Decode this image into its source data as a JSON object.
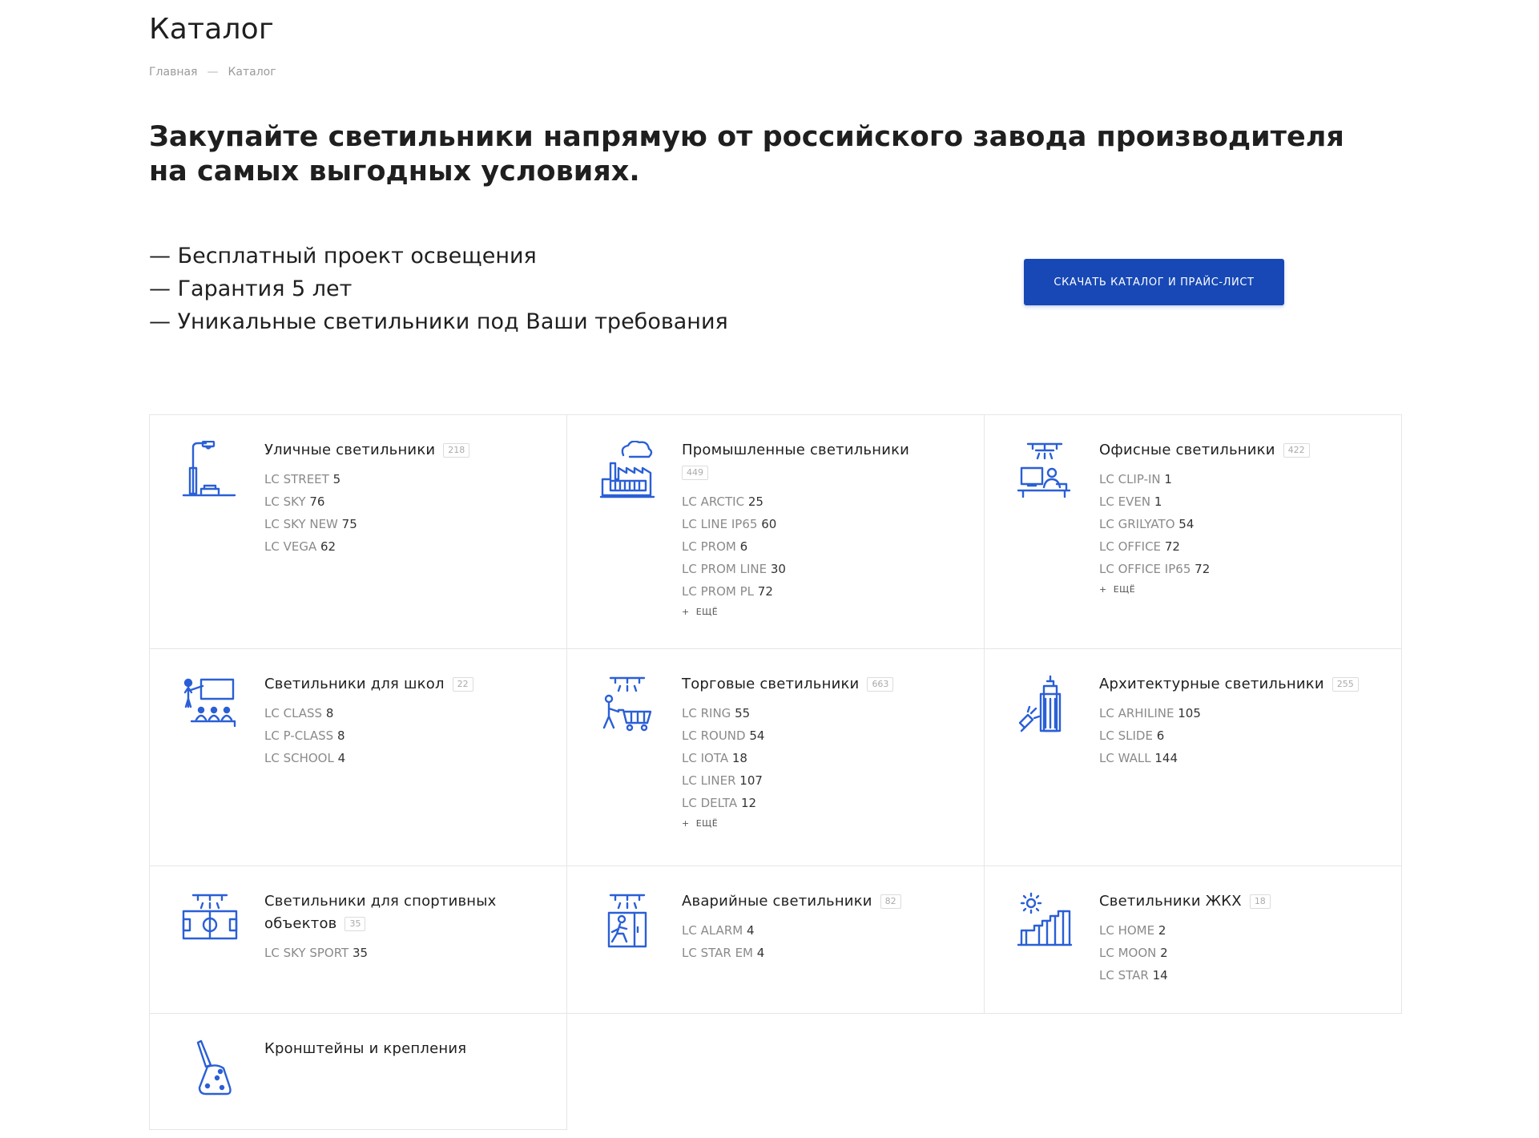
{
  "page": {
    "title": "Каталог",
    "breadcrumb": {
      "home": "Главная",
      "separator": "—",
      "current": "Каталог"
    },
    "headline": "Закупайте светильники напрямую от российского завода производителя на самых выгодных условиях.",
    "benefits": [
      "— Бесплатный проект освещения",
      "— Гарантия 5 лет",
      "— Уникальные светильники под Ваши требования"
    ],
    "cta_label": "СКАЧАТЬ КАТАЛОГ И ПРАЙС-ЛИСТ"
  },
  "theme": {
    "accent": "#1748b6",
    "icon": "#2a5fd6",
    "border": "#e6e6e6",
    "muted": "#8a8a8a"
  },
  "more_label": "ЕЩЁ",
  "more_plus": "+",
  "categories": [
    {
      "title": "Уличные светильники",
      "count": "218",
      "icon": "street-light-icon",
      "items": [
        {
          "name": "LC STREET",
          "count": "5"
        },
        {
          "name": "LC SKY",
          "count": "76"
        },
        {
          "name": "LC SKY NEW",
          "count": "75"
        },
        {
          "name": "LC VEGA",
          "count": "62"
        }
      ]
    },
    {
      "title": "Промышленные светильники",
      "count": "449",
      "icon": "factory-icon",
      "items": [
        {
          "name": "LC ARCTIC",
          "count": "25"
        },
        {
          "name": "LC LINE IP65",
          "count": "60"
        },
        {
          "name": "LC PROM",
          "count": "6"
        },
        {
          "name": "LC PROM LINE",
          "count": "30"
        },
        {
          "name": "LC PROM PL",
          "count": "72"
        }
      ]
    },
    {
      "title": "Офисные светильники",
      "count": "422",
      "icon": "office-desk-icon",
      "items": [
        {
          "name": "LC CLIP-IN",
          "count": "1"
        },
        {
          "name": "LC EVEN",
          "count": "1"
        },
        {
          "name": "LC GRILYATO",
          "count": "54"
        },
        {
          "name": "LC OFFICE",
          "count": "72"
        },
        {
          "name": "LC OFFICE IP65",
          "count": "72"
        }
      ]
    },
    {
      "title": "Светильники для школ",
      "count": "22",
      "icon": "classroom-icon",
      "items": [
        {
          "name": "LC CLASS",
          "count": "8"
        },
        {
          "name": "LC P-CLASS",
          "count": "8"
        },
        {
          "name": "LC SCHOOL",
          "count": "4"
        }
      ]
    },
    {
      "title": "Торговые светильники",
      "count": "663",
      "icon": "shopping-cart-icon",
      "items": [
        {
          "name": "LC RING",
          "count": "55"
        },
        {
          "name": "LC ROUND",
          "count": "54"
        },
        {
          "name": "LC IOTA",
          "count": "18"
        },
        {
          "name": "LC LINER",
          "count": "107"
        },
        {
          "name": "LC DELTA",
          "count": "12"
        }
      ]
    },
    {
      "title": "Архитектурные светильники",
      "count": "255",
      "icon": "building-spotlight-icon",
      "items": [
        {
          "name": "LC ARHILINE",
          "count": "105"
        },
        {
          "name": "LC SLIDE",
          "count": "6"
        },
        {
          "name": "LC WALL",
          "count": "144"
        }
      ]
    },
    {
      "title_line1": "Светильники для спортивных",
      "title_line2": "объектов",
      "count": "35",
      "icon": "sport-field-icon",
      "items": [
        {
          "name": "LC SKY SPORT",
          "count": "35"
        }
      ]
    },
    {
      "title": "Аварийные светильники",
      "count": "82",
      "icon": "emergency-exit-icon",
      "items": [
        {
          "name": "LC ALARM",
          "count": "4"
        },
        {
          "name": "LC STAR EM",
          "count": "4"
        }
      ]
    },
    {
      "title": "Светильники ЖКХ",
      "count": "18",
      "icon": "stairs-sun-icon",
      "items": [
        {
          "name": "LC HOME",
          "count": "2"
        },
        {
          "name": "LC MOON",
          "count": "2"
        },
        {
          "name": "LC STAR",
          "count": "14"
        }
      ]
    },
    {
      "title": "Кронштейны и крепления",
      "icon": "bracket-mount-icon",
      "items": []
    }
  ]
}
